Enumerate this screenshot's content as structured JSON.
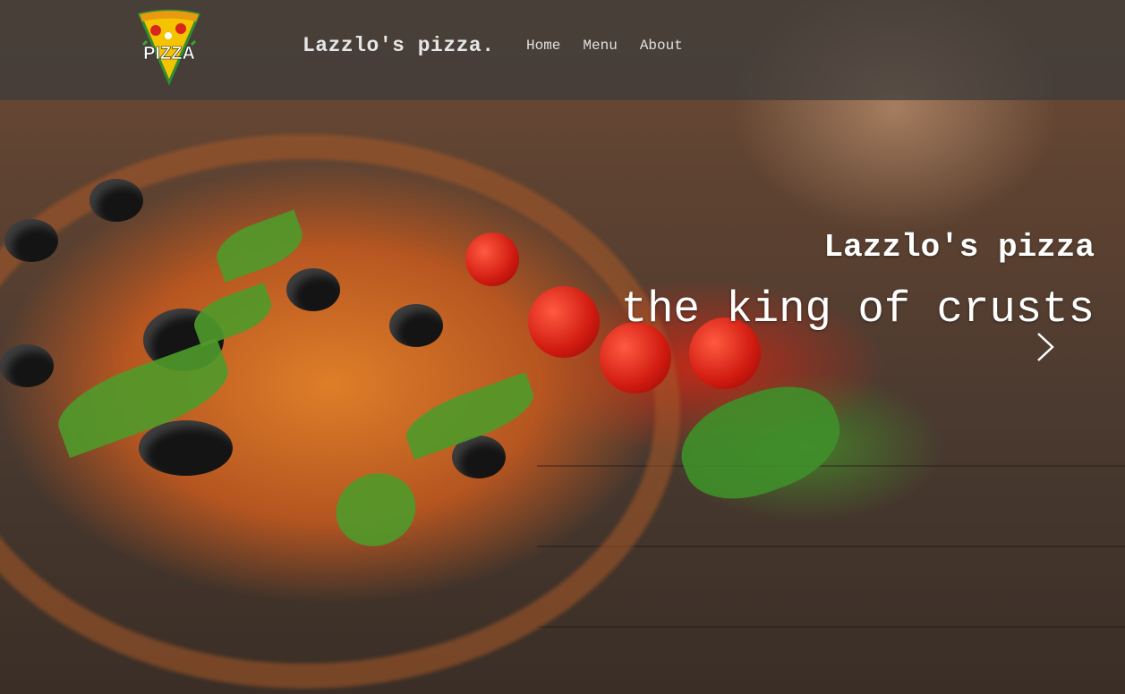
{
  "header": {
    "logo_text": "PIZZA",
    "brand": "Lazzlo's pizza.",
    "nav": [
      {
        "label": "Home"
      },
      {
        "label": "Menu"
      },
      {
        "label": "About"
      }
    ]
  },
  "hero": {
    "title": "Lazzlo's pizza",
    "subtitle": "the king of crusts",
    "next_icon": "chevron-right-icon"
  },
  "colors": {
    "nav_bg": "#3c3c3c",
    "nav_text": "#e0e0e0",
    "hero_text": "#ffffff",
    "logo_yellow": "#f5c400",
    "logo_green": "#3aa63a"
  }
}
